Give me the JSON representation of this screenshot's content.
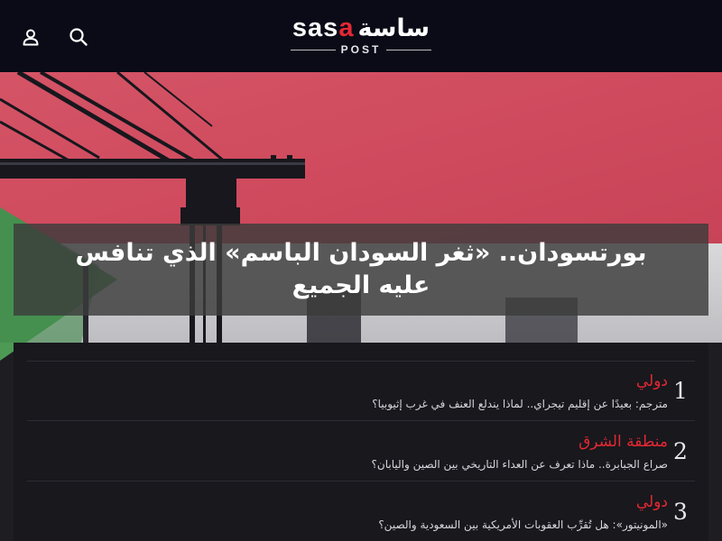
{
  "header": {
    "logo": {
      "latin_main": "sas",
      "latin_accent": "a",
      "arabic": "ساسة",
      "sub": "POST"
    },
    "icons": {
      "user": "user-icon",
      "search": "search-icon"
    }
  },
  "hero": {
    "title": "بورتسودان.. «ثغر السودان الباسم» الذي تنافس عليه الجميع"
  },
  "most_read": {
    "items": [
      {
        "number": "1",
        "category": "دولي",
        "headline": "مترجم: بعيدًا عن إقليم تيجراي.. لماذا يندلع العنف في غرب إثيوبيا؟"
      },
      {
        "number": "2",
        "category": "منطقة الشرق",
        "headline": "صراع الجبابرة.. ماذا تعرف عن العداء التاريخي بين الصين واليابان؟"
      },
      {
        "number": "3",
        "category": "دولي",
        "headline": "«المونيتور»: هل تُقرِّب العقوبات الأمريكية بين السعودية والصين؟"
      }
    ]
  },
  "colors": {
    "accent": "#e52833",
    "header_bg": "#0b0b18",
    "panel_bg": "#18181d",
    "flag_red": "#d04a5c",
    "flag_green": "#4e9a55"
  }
}
